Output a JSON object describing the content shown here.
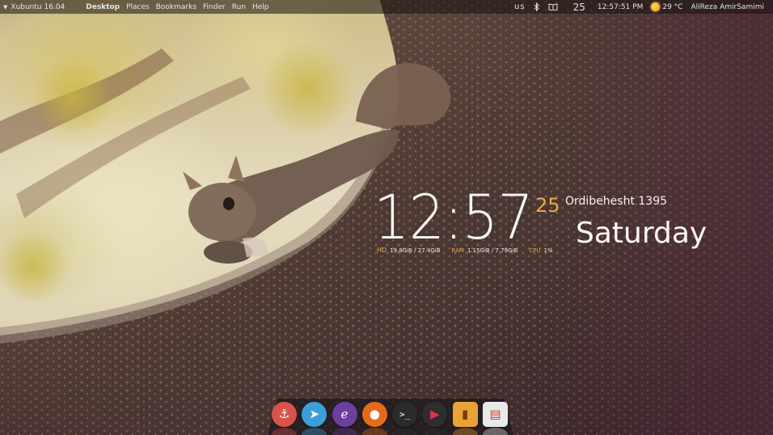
{
  "panel": {
    "os_label": "Xubuntu 16.04",
    "menus": [
      {
        "label": "Desktop",
        "active": true
      },
      {
        "label": "Places"
      },
      {
        "label": "Bookmarks"
      },
      {
        "label": "Finder"
      },
      {
        "label": "Run"
      },
      {
        "label": "Help"
      }
    ],
    "keyboard_layout": "us",
    "tray_icons": [
      "bluetooth-icon",
      "book-icon"
    ],
    "date_day": "25",
    "time": "12:57:51 PM",
    "weather_icon": "sun-icon",
    "temperature": "29 °C",
    "user": "AliReza AmirSamimi"
  },
  "conky": {
    "time": "12:57",
    "day_number": "25",
    "month_year": "Ordibehesht 1395",
    "weekday": "Saturday",
    "hd_label": "HD",
    "hd_value": "19.8GiB / 27.4GiB",
    "ram_label": "RAM",
    "ram_value": "1.15GiB / 7.79GiB",
    "cpu_label": "CPU",
    "cpu_value": "1%",
    "accent_color": "#f2a54c"
  },
  "dock": {
    "items": [
      {
        "name": "anchor-icon",
        "label": "⚓",
        "color": "#d9534b"
      },
      {
        "name": "telegram-icon",
        "label": "➤",
        "color": "#3a9fd9"
      },
      {
        "name": "emacs-icon",
        "label": "ℯ",
        "color": "#6b3fa0"
      },
      {
        "name": "firefox-icon",
        "label": "●",
        "color": "#e66a1c"
      },
      {
        "name": "terminal-icon",
        "label": ">_",
        "color": "#2b2b2b"
      },
      {
        "name": "media-player-icon",
        "label": "▶",
        "color": "#2e2e2e"
      },
      {
        "name": "book-reader-icon",
        "label": "▮",
        "color": "#e9a236"
      },
      {
        "name": "document-viewer-icon",
        "label": "▤",
        "color": "#e9e9e9"
      }
    ]
  }
}
